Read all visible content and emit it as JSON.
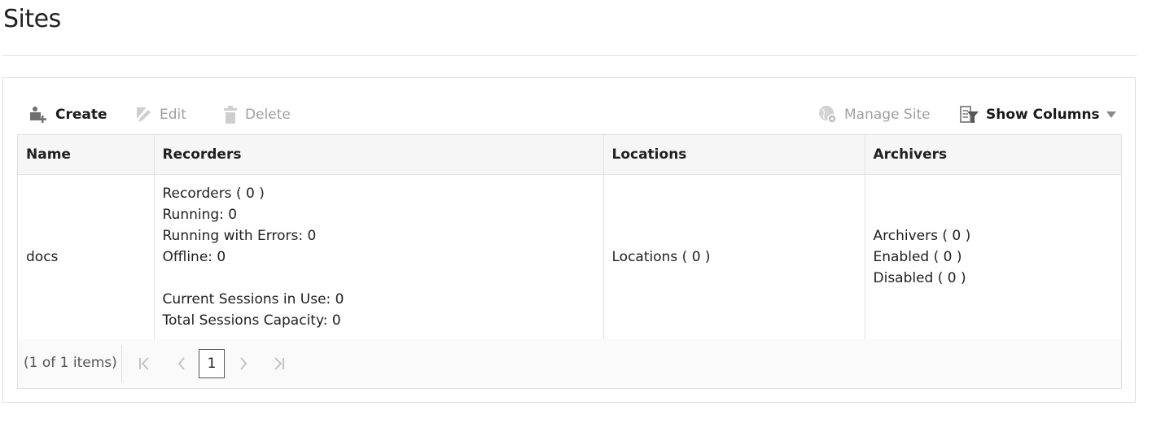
{
  "page": {
    "title": "Sites"
  },
  "toolbar": {
    "create": {
      "label": "Create",
      "icon": "user-add-icon",
      "enabled": true
    },
    "edit": {
      "label": "Edit",
      "icon": "pencil-icon",
      "enabled": false
    },
    "delete": {
      "label": "Delete",
      "icon": "trash-icon",
      "enabled": false
    },
    "manage_site": {
      "label": "Manage Site",
      "icon": "globe-gear-icon",
      "enabled": false
    },
    "show_columns": {
      "label": "Show Columns",
      "icon": "column-filter-icon",
      "enabled": true
    },
    "menu": {
      "icon": "caret-down-icon"
    }
  },
  "grid": {
    "columns": [
      "Name",
      "Recorders",
      "Locations",
      "Archivers"
    ],
    "rows": [
      {
        "name": "docs",
        "recorders": {
          "total": "Recorders ( 0 )",
          "running": "Running: 0",
          "running_errors": "Running with Errors: 0",
          "offline": "Offline: 0",
          "current_sessions": "Current Sessions in Use: 0",
          "total_capacity": "Total Sessions Capacity: 0"
        },
        "locations": "Locations ( 0 )",
        "archivers": {
          "total": "Archivers ( 0 )",
          "enabled": "Enabled ( 0 )",
          "disabled": "Disabled ( 0 )"
        }
      }
    ]
  },
  "pager": {
    "info": "(1 of 1 items)",
    "current_page": "1",
    "first_icon": "first-page-icon",
    "prev_icon": "prev-page-icon",
    "next_icon": "next-page-icon",
    "last_icon": "last-page-icon"
  },
  "colors": {
    "text": "#212121",
    "disabled": "#a0a0a0",
    "border": "#e0e0e0",
    "header_bg": "#f6f6f6"
  }
}
